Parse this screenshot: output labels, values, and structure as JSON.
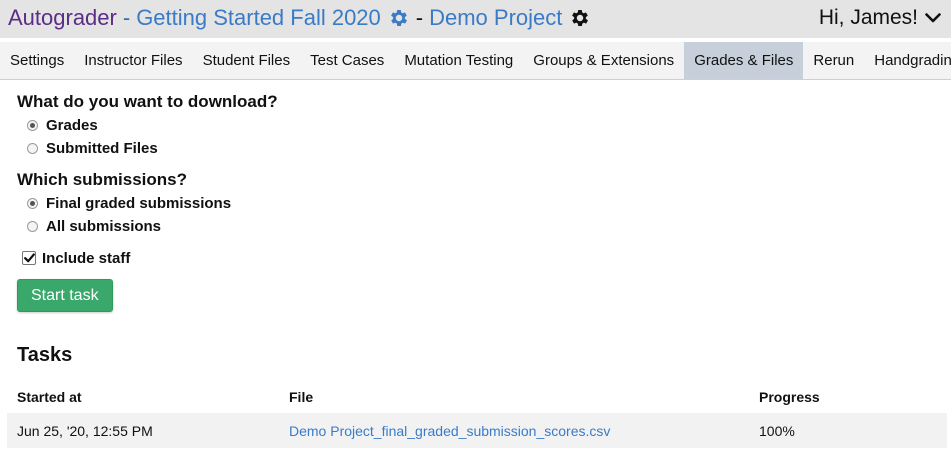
{
  "header": {
    "app_name": "Autograder",
    "separator": "-",
    "course": "Getting Started Fall 2020",
    "project": "Demo Project",
    "greeting": "Hi, James!"
  },
  "tabs": [
    {
      "label": "Settings",
      "active": false
    },
    {
      "label": "Instructor Files",
      "active": false
    },
    {
      "label": "Student Files",
      "active": false
    },
    {
      "label": "Test Cases",
      "active": false
    },
    {
      "label": "Mutation Testing",
      "active": false
    },
    {
      "label": "Groups & Extensions",
      "active": false
    },
    {
      "label": "Grades & Files",
      "active": true
    },
    {
      "label": "Rerun",
      "active": false
    },
    {
      "label": "Handgrading",
      "active": false
    }
  ],
  "download": {
    "question": "What do you want to download?",
    "options": [
      {
        "label": "Grades",
        "selected": true
      },
      {
        "label": "Submitted Files",
        "selected": false
      }
    ]
  },
  "submissions": {
    "question": "Which submissions?",
    "options": [
      {
        "label": "Final graded submissions",
        "selected": true
      },
      {
        "label": "All submissions",
        "selected": false
      }
    ]
  },
  "include_staff": {
    "label": "Include staff",
    "checked": true
  },
  "start_button": "Start task",
  "tasks": {
    "title": "Tasks",
    "columns": [
      "Started at",
      "File",
      "Progress"
    ],
    "rows": [
      {
        "started_at": "Jun 25, '20, 12:55 PM",
        "file": "Demo Project_final_graded_submission_scores.csv",
        "progress": "100%"
      }
    ]
  },
  "colors": {
    "app_name": "#5b2d86",
    "link": "#3a7bc8",
    "active_tab": "#c7d0da",
    "button": "#3aa86b"
  }
}
